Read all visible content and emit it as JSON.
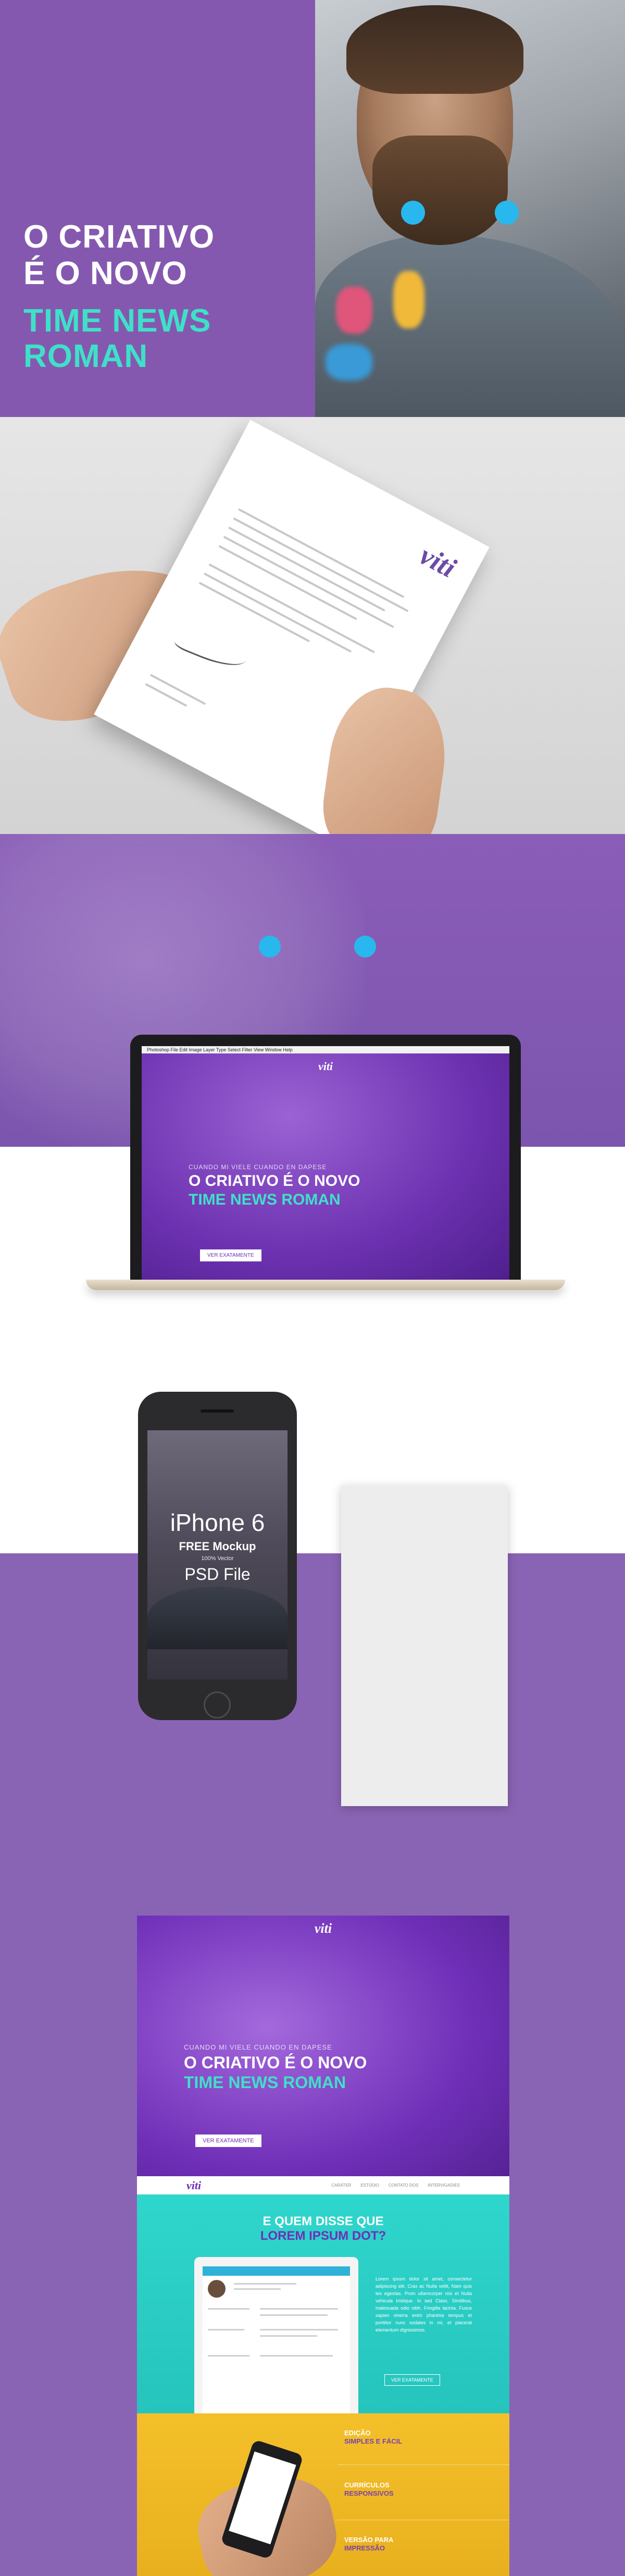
{
  "hero": {
    "line1": "O CRIATIVO",
    "line2": "É O NOVO",
    "line3": "TIME NEWS",
    "line4": "ROMAN"
  },
  "letter": {
    "brand": "viti"
  },
  "laptop": {
    "menubar": "Photoshop  File  Edit  Image  Layer  Type  Select  Filter  View  Window  Help",
    "brand": "viti",
    "small": "CUANDO MI VIELE CUANDO EN DAPESE",
    "title1": "O CRIATIVO É O NOVO",
    "title2": "TIME NEWS ROMAN",
    "button": "VER EXATAMENTE"
  },
  "phone": {
    "line1": "iPhone 6",
    "line2": "FREE Mockup",
    "line3": "100% Vector",
    "line4": "PSD File"
  },
  "site": {
    "logo": "viti",
    "small": "CUANDO MI VIELE CUANDO EN DAPESE",
    "title1": "O CRIATIVO É O NOVO",
    "title2": "TIME NEWS ROMAN",
    "button": "VER EXATAMENTE",
    "nav_logo": "viti",
    "nav_links": [
      "CARÁTER",
      "ESTÚDIO",
      "CONTATO DOS",
      "INTERVIGADIES"
    ],
    "question1": "E QUEM DISSE QUE",
    "question2": "LOREM IPSUM DOT?",
    "paragraph": "Lorem ipsum dolor sit amet, consectetur adipiscing elit. Cras ac Nulla vellit, Nam quis leo egestas. Proin ullamcorper nisi et Nulla vehicula tristique. In sed Class. Similibus, malesuada odio nibh. Fringilla lacinia. Fusce sapien viverra enim pharetra tempus et porttitor nunc sodales in mi, et placerat elementum dignissimos.",
    "teal_button": "VER EXATAMENTE",
    "features": [
      {
        "a": "EDIÇÃO",
        "b": "SIMPLES E FÁCIL"
      },
      {
        "a": "CURRÍCULOS",
        "b": "RESPONSIVOS"
      },
      {
        "a": "VERSÃO PARA",
        "b": "IMPRESSÃO"
      }
    ]
  },
  "colors": {
    "purple": "#8558b0",
    "teal": "#3fe0c8",
    "dot_blue": "#28b8ee",
    "yellow": "#f4c02a"
  }
}
